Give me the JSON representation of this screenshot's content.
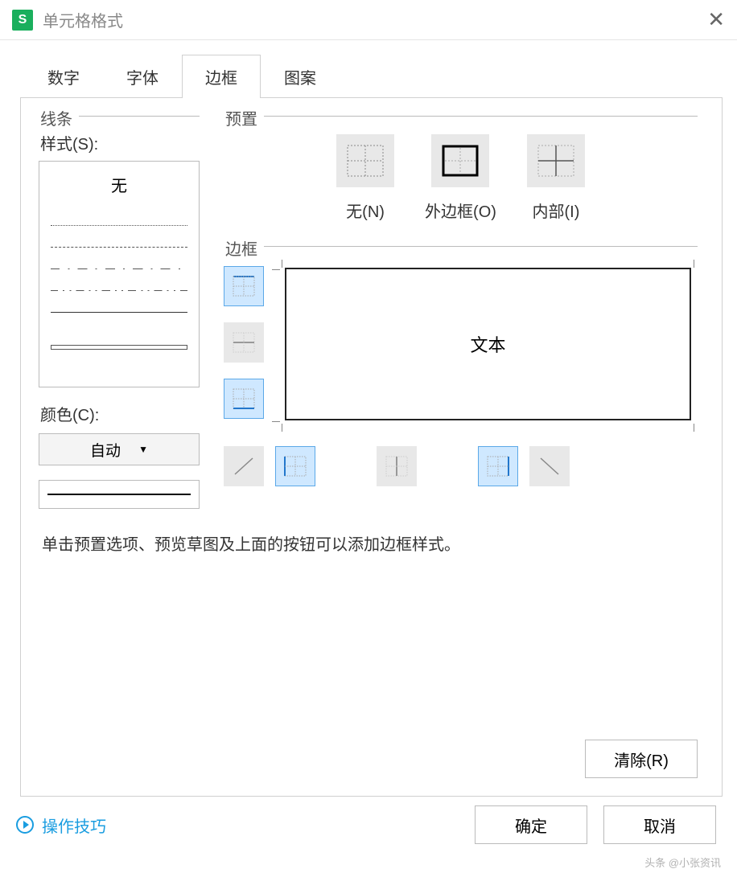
{
  "titlebar": {
    "icon_letter": "S",
    "title": "单元格格式"
  },
  "tabs": {
    "items": [
      "数字",
      "字体",
      "边框",
      "图案"
    ],
    "active_index": 2
  },
  "line": {
    "legend": "线条",
    "style_label": "样式(S):",
    "none_label": "无",
    "color_label": "颜色(C):",
    "color_value": "自动"
  },
  "preset": {
    "legend": "预置",
    "none": "无(N)",
    "outer": "外边框(O)",
    "inner": "内部(I)"
  },
  "border": {
    "legend": "边框",
    "preview_text": "文本"
  },
  "help_text": "单击预置选项、预览草图及上面的按钮可以添加边框样式。",
  "buttons": {
    "clear": "清除(R)",
    "ok": "确定",
    "cancel": "取消"
  },
  "tips_link": "操作技巧",
  "watermark": "头条 @小张资讯"
}
